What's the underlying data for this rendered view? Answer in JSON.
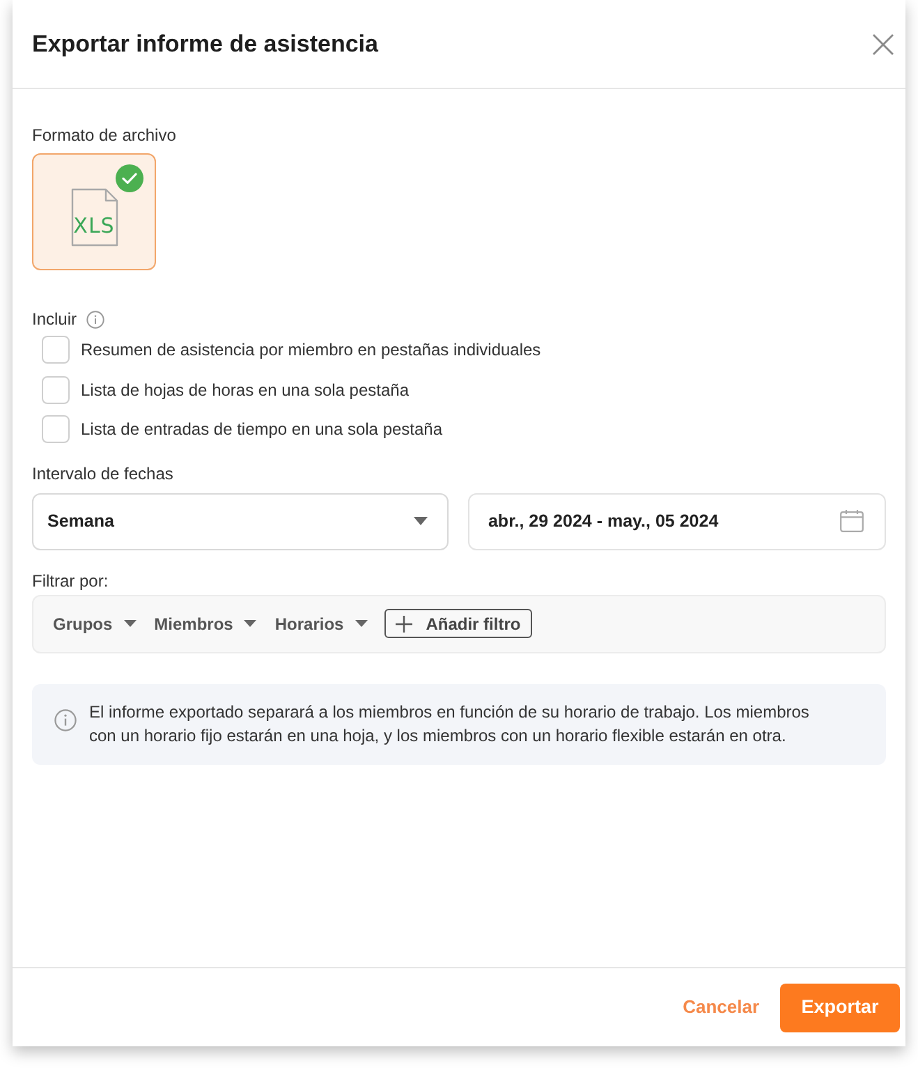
{
  "dialog": {
    "title": "Exportar informe de asistencia"
  },
  "file_format": {
    "label": "Formato de archivo",
    "options": [
      {
        "label": "XLS",
        "selected": true
      }
    ]
  },
  "include": {
    "label": "Incluir",
    "options": [
      {
        "label": "Resumen de asistencia por miembro en pestañas individuales",
        "checked": false
      },
      {
        "label": "Lista de hojas de horas en una sola pestaña",
        "checked": false
      },
      {
        "label": "Lista de entradas de tiempo en una sola pestaña",
        "checked": false
      }
    ]
  },
  "date_range": {
    "label": "Intervalo de fechas",
    "period": "Semana",
    "range": "abr., 29 2024 - may., 05 2024"
  },
  "filter": {
    "label": "Filtrar por:",
    "dropdowns": [
      "Grupos",
      "Miembros",
      "Horarios"
    ],
    "add_button": "Añadir filtro"
  },
  "info_note": "El informe exportado separará a los miembros en función de su horario de trabajo. Los miembros con un horario fijo estarán en una hoja, y los miembros con un horario flexible estarán en otra.",
  "footer": {
    "buttons": [
      {
        "label": "Cancelar",
        "kind": "secondary"
      },
      {
        "label": "Exportar",
        "kind": "primary"
      }
    ]
  }
}
